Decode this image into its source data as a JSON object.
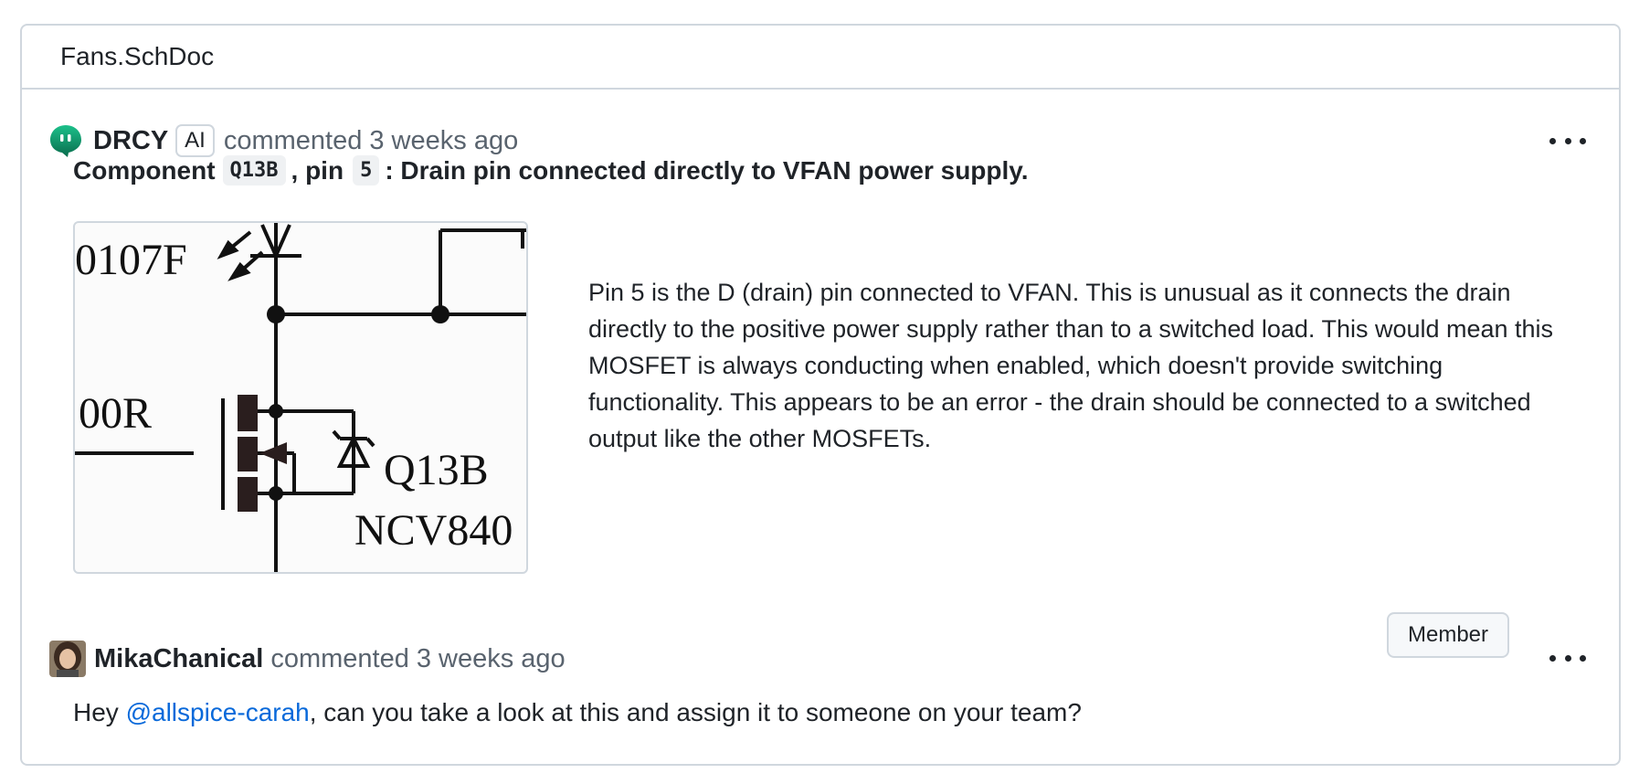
{
  "panel": {
    "file_name": "Fans.SchDoc"
  },
  "comments": [
    {
      "author": "DRCY",
      "badge": "AI",
      "verb": "commented",
      "time": "3 weeks ago",
      "title": {
        "prefix": "Component",
        "component": "Q13B",
        "middle": ", pin",
        "pin": "5",
        "suffix": ": Drain pin connected directly to VFAN power supply."
      },
      "schematic_labels": {
        "ref1": "0107F",
        "ref2": "00R",
        "part": "Q13B",
        "value": "NCV840"
      },
      "body": "Pin 5 is the D (drain) pin connected to VFAN. This is unusual as it connects the drain directly to the positive power supply rather than to a switched load. This would mean this MOSFET is always conducting when enabled, which doesn't provide switching functionality. This appears to be an error - the drain should be connected to a switched output like the other MOSFETs."
    },
    {
      "author": "MikaChanical",
      "verb": "commented",
      "time": "3 weeks ago",
      "role_badge": "Member",
      "body_prefix": "Hey ",
      "mention": "@allspice-carah",
      "body_suffix": ", can you take a look at this and assign it to someone on your team?"
    }
  ],
  "icons": {
    "drcy_avatar": "drcy-avatar-icon",
    "more": "kebab-menu-icon"
  },
  "colors": {
    "accent_link": "#0969da",
    "border": "#d0d7de",
    "drcy_green": "#1aa872"
  }
}
